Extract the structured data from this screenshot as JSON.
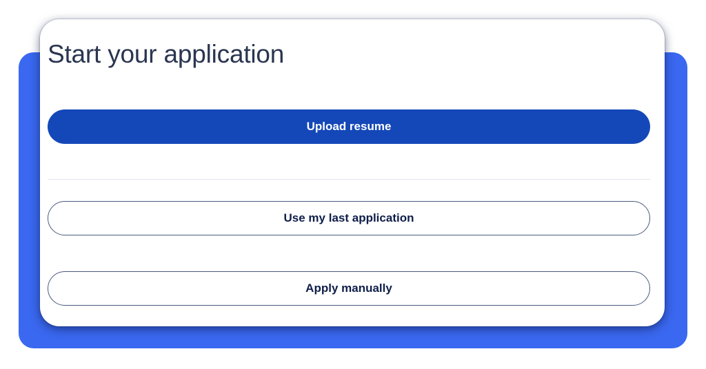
{
  "page": {
    "title": "Start your application"
  },
  "actions": {
    "upload_resume_label": "Upload resume",
    "use_last_application_label": "Use my last application",
    "apply_manually_label": "Apply manually"
  },
  "colors": {
    "backdrop": "#3a68f0",
    "primary_button": "#1448b8",
    "outline_border": "#4a5a7e",
    "title_text": "#2a3550",
    "button_text_dark": "#0f1e4a"
  }
}
